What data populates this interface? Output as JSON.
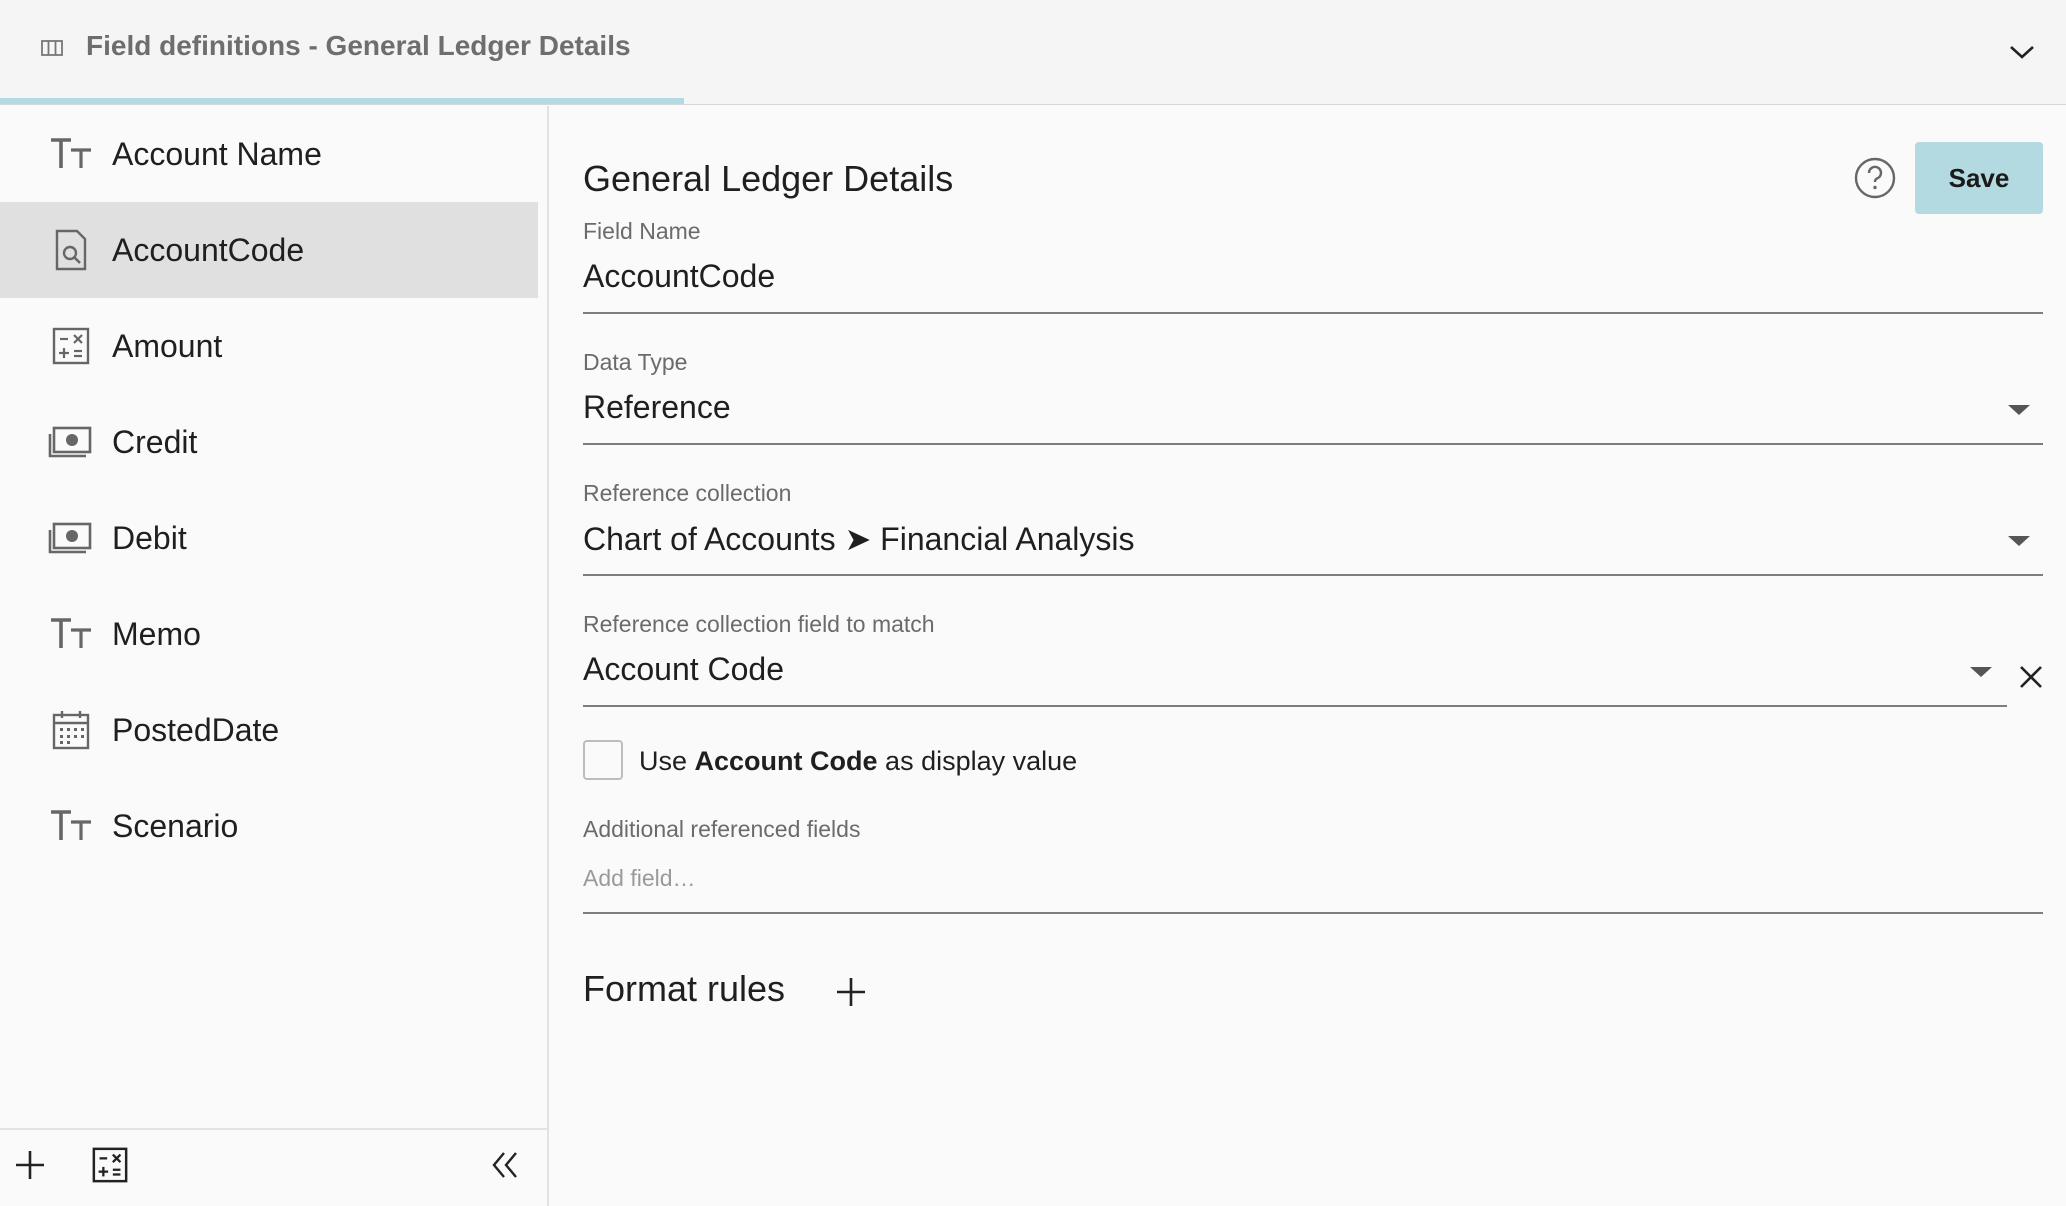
{
  "header": {
    "title": "Field definitions - General Ledger Details",
    "title_icon": "columns-icon",
    "collapse_icon": "chevron-down-icon"
  },
  "sidebar": {
    "items": [
      {
        "label": "Account Name",
        "icon": "text-type-icon",
        "selected": false
      },
      {
        "label": "AccountCode",
        "icon": "document-search-icon",
        "selected": true
      },
      {
        "label": "Amount",
        "icon": "calculator-icon",
        "selected": false
      },
      {
        "label": "Credit",
        "icon": "money-icon",
        "selected": false
      },
      {
        "label": "Debit",
        "icon": "money-icon",
        "selected": false
      },
      {
        "label": "Memo",
        "icon": "text-type-icon",
        "selected": false
      },
      {
        "label": "PostedDate",
        "icon": "calendar-icon",
        "selected": false
      },
      {
        "label": "Scenario",
        "icon": "text-type-icon",
        "selected": false
      }
    ],
    "footer": {
      "add_icon": "plus-icon",
      "calc_icon": "calculator-icon",
      "collapse_icon": "double-chevron-left-icon"
    }
  },
  "main": {
    "title": "General Ledger Details",
    "help_icon": "help-circle-icon",
    "save_label": "Save",
    "field_name": {
      "label": "Field Name",
      "value": "AccountCode"
    },
    "data_type": {
      "label": "Data Type",
      "value": "Reference"
    },
    "reference_collection": {
      "label": "Reference collection",
      "value": "Chart of Accounts ➤ Financial Analysis"
    },
    "match_field": {
      "label": "Reference collection field to match",
      "value": "Account Code"
    },
    "display_value": {
      "prefix": "Use ",
      "bold": "Account Code",
      "suffix": " as display value",
      "checked": false
    },
    "additional_fields": {
      "label": "Additional referenced fields",
      "placeholder": "Add field…"
    },
    "format_rules": {
      "title": "Format rules",
      "add_icon": "plus-icon"
    }
  },
  "colors": {
    "accent": "#b3d9e1",
    "selected_row": "#e0e0e0",
    "progress": "#b3d9e3"
  }
}
